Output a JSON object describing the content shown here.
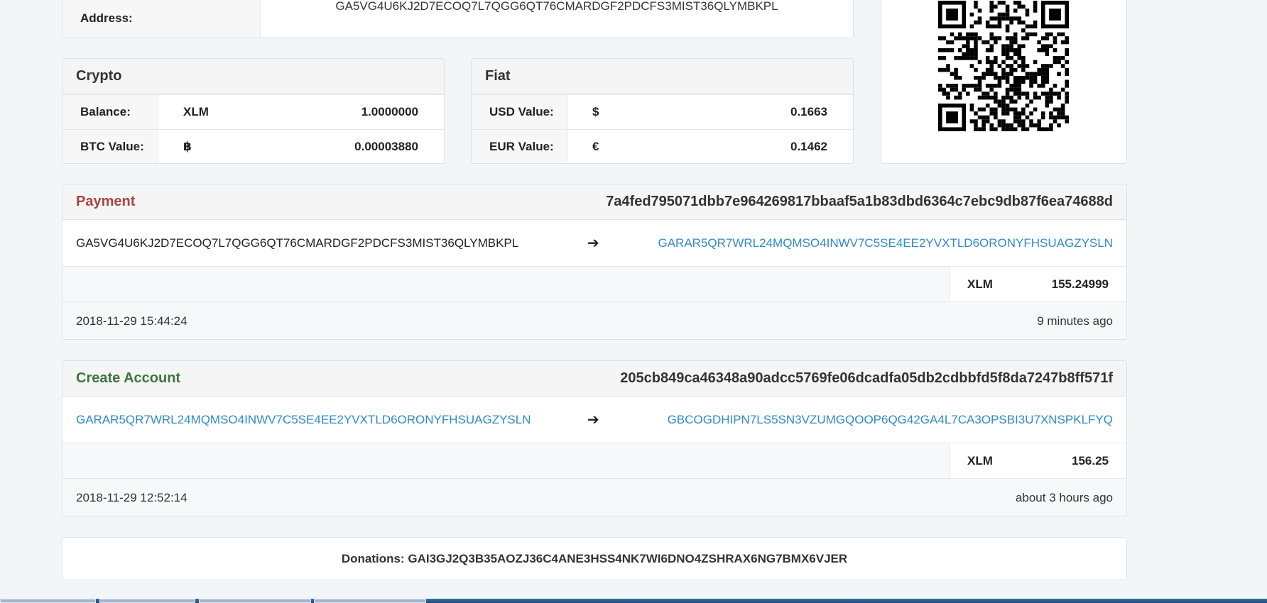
{
  "address": {
    "label": "Address:",
    "value": "GA5VG4U6KJ2D7ECOQ7L7QGG6QT76CMARDGF2PDCFS3MIST36QLYMBKPL"
  },
  "crypto": {
    "title": "Crypto",
    "rows": [
      {
        "label": "Balance:",
        "unit": "XLM",
        "value": "1.0000000"
      },
      {
        "label": "BTC Value:",
        "unit": "฿",
        "value": "0.00003880"
      }
    ]
  },
  "fiat": {
    "title": "Fiat",
    "rows": [
      {
        "label": "USD Value:",
        "unit": "$",
        "value": "0.1663"
      },
      {
        "label": "EUR Value:",
        "unit": "€",
        "value": "0.1462"
      }
    ]
  },
  "transactions": [
    {
      "type": "Payment",
      "type_color": "#a94442",
      "hash": "7a4fed795071dbb7e964269817bbaaf5a1b83dbd6364c7ebc9db87f6ea74688d",
      "from": "GA5VG4U6KJ2D7ECOQ7L7QGG6QT76CMARDGF2PDCFS3MIST36QLYMBKPL",
      "arrow": "➔",
      "to": "GARAR5QR7WRL24MQMSO4INWV7C5SE4EE2YVXTLD6ORONYFHSUAGZYSLN",
      "currency": "XLM",
      "amount": "155.24999",
      "date": "2018-11-29 15:44:24",
      "ago": "9 minutes ago"
    },
    {
      "type": "Create Account",
      "type_color": "#3c763d",
      "hash": "205cb849ca46348a90adcc5769fe06dcadfa05db2cdbbfd5f8da7247b8ff571f",
      "from": "GARAR5QR7WRL24MQMSO4INWV7C5SE4EE2YVXTLD6ORONYFHSUAGZYSLN",
      "arrow": "➔",
      "to": "GBCOGDHIPN7LS5SN3VZUMGQOOP6QG42GA4L7CA3OPSBI3U7XNSPKLFYQ",
      "currency": "XLM",
      "amount": "156.25",
      "date": "2018-11-29 12:52:14",
      "ago": "about 3 hours ago"
    }
  ],
  "donations": {
    "label": "Donations:",
    "address": "GAI3GJ2Q3B35AOZJ36C4ANE3HSS4NK7WI6DNO4ZSHRAX6NG7BMX6VJER"
  },
  "colors": {
    "link": "#2e8bc9",
    "background": "#f3f6f9"
  }
}
